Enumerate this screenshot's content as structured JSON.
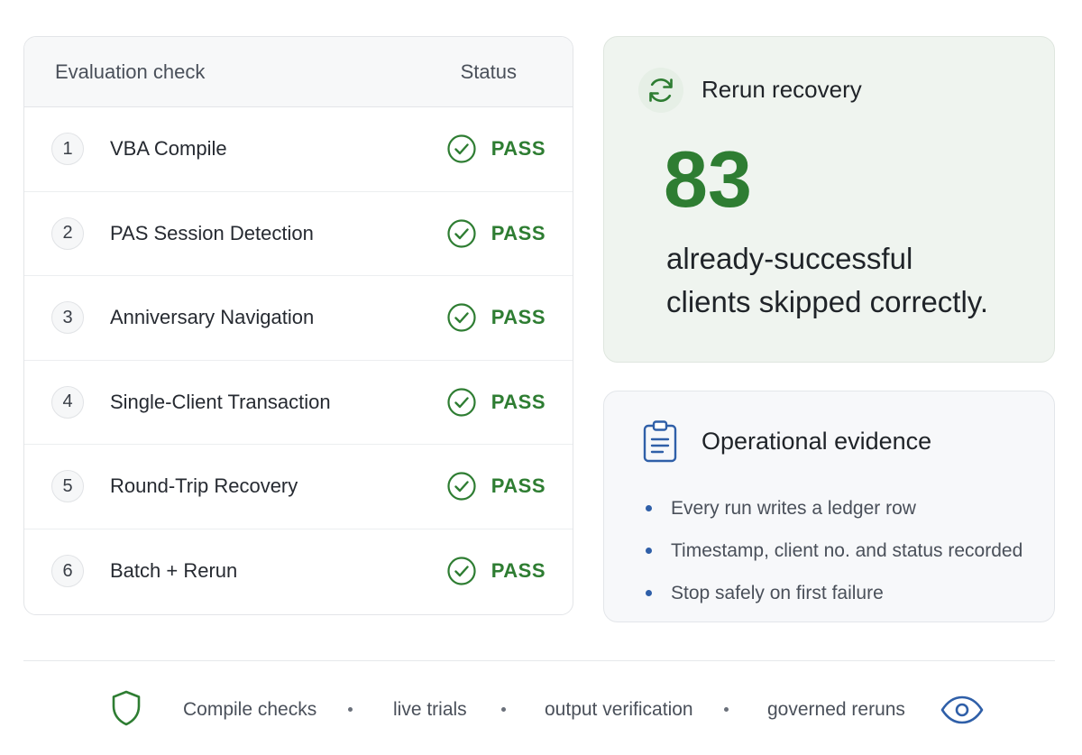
{
  "evaluation": {
    "header_check": "Evaluation check",
    "header_status": "Status",
    "rows": [
      {
        "num": "1",
        "label": "VBA Compile",
        "status": "PASS"
      },
      {
        "num": "2",
        "label": "PAS Session Detection",
        "status": "PASS"
      },
      {
        "num": "3",
        "label": "Anniversary Navigation",
        "status": "PASS"
      },
      {
        "num": "4",
        "label": "Single-Client Transaction",
        "status": "PASS"
      },
      {
        "num": "5",
        "label": "Round-Trip Recovery",
        "status": "PASS"
      },
      {
        "num": "6",
        "label": "Batch + Rerun",
        "status": "PASS"
      }
    ],
    "status_icon": "check-circle-icon"
  },
  "rerun": {
    "icon": "refresh-icon",
    "title": "Rerun recovery",
    "number": "83",
    "description_line1": "already-successful",
    "description_line2": "clients skipped correctly."
  },
  "evidence": {
    "icon": "clipboard-icon",
    "title": "Operational evidence",
    "items": [
      "Every run writes a ledger row",
      "Timestamp, client no. and status recorded",
      "Stop safely on first failure"
    ]
  },
  "footer": {
    "left_icon": "shield-icon",
    "right_icon": "eye-icon",
    "items": [
      "Compile checks",
      "live trials",
      "output verification",
      "governed reruns"
    ]
  },
  "colors": {
    "pass_green": "#2e7d32",
    "accent_blue": "#2f5fa8",
    "rerun_card_bg": "#eff4ef",
    "evidence_card_bg": "#f7f8fa"
  }
}
